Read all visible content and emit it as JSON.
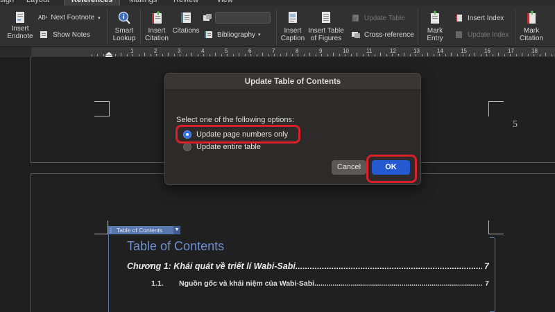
{
  "ribbon": {
    "tabs": [
      {
        "label": "sign"
      },
      {
        "label": "Layout"
      },
      {
        "label": "References"
      },
      {
        "label": "Mailings"
      },
      {
        "label": "Review"
      },
      {
        "label": "View"
      }
    ],
    "insert_endnote": "Insert Endnote",
    "next_footnote": "Next Footnote",
    "show_notes": "Show Notes",
    "smart_lookup": "Smart Lookup",
    "insert_citation": "Insert Citation",
    "citations": "Citations",
    "bibliography": "Bibliography",
    "insert_caption": "Insert Caption",
    "insert_table_of_figures": "Insert Table of Figures",
    "update_table": "Update Table",
    "cross_reference": "Cross-reference",
    "mark_entry": "Mark Entry",
    "insert_index": "Insert Index",
    "update_index": "Update Index",
    "mark_citation": "Mark Citation"
  },
  "ruler": {
    "numbers": [
      "1",
      "2",
      "3",
      "4",
      "5",
      "6",
      "7",
      "8",
      "9",
      "10",
      "11",
      "12",
      "13",
      "14",
      "15",
      "16",
      "17",
      "18"
    ]
  },
  "document": {
    "page_number": "5",
    "toc_control_label": "Table of Contents",
    "toc_title": "Table of Contents",
    "toc_entries": [
      {
        "text": "Chương 1: Khái quát về triết lí Wabi-Sabi",
        "page": "7"
      },
      {
        "number": "1.1.",
        "text": "Nguồn gốc và khái niệm của Wabi-Sabi",
        "page": "7"
      }
    ]
  },
  "dialog": {
    "title": "Update Table of Contents",
    "prompt": "Select one of the following options:",
    "options": [
      {
        "label": "Update page numbers only",
        "selected": true
      },
      {
        "label": "Update entire table",
        "selected": false
      }
    ],
    "cancel_label": "Cancel",
    "ok_label": "OK"
  },
  "colors": {
    "highlight": "#d81f2a",
    "accent": "#2459cf",
    "toc_title": "#6b8fd1"
  },
  "icons": [
    "footnote-icon",
    "show-notes-icon",
    "smart-lookup-icon",
    "insert-citation-icon",
    "citations-icon",
    "bibliography-icon",
    "insert-caption-icon",
    "table-of-figures-icon",
    "update-table-icon",
    "cross-reference-icon",
    "mark-entry-icon",
    "insert-index-icon",
    "update-index-icon",
    "mark-citation-icon"
  ]
}
